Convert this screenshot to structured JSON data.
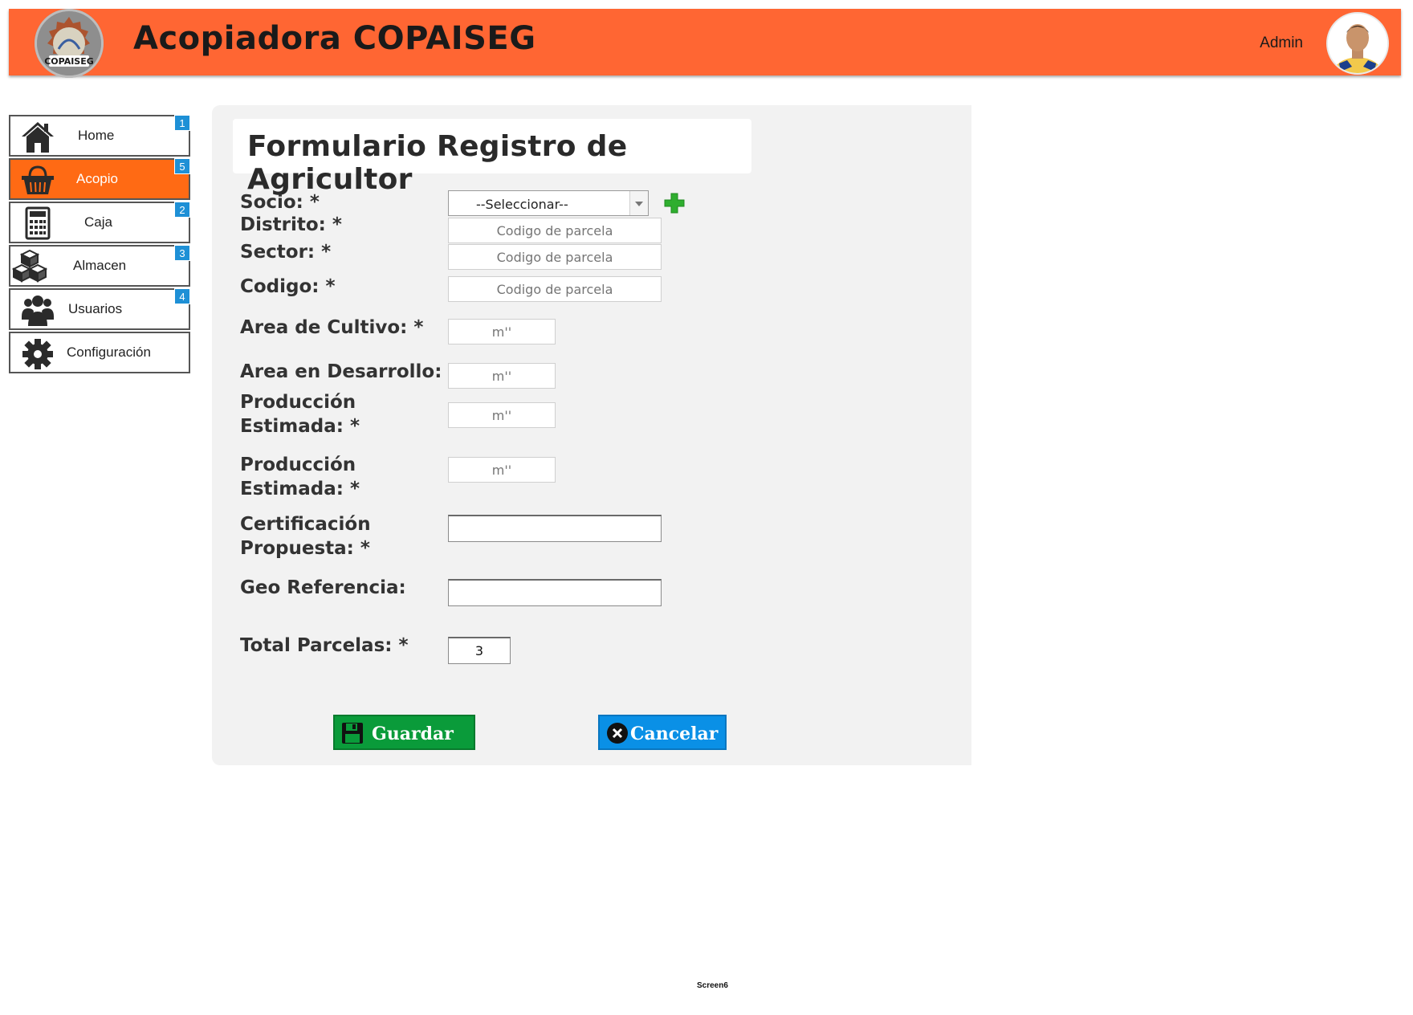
{
  "header": {
    "app_title": "Acopiadora COPAISEG",
    "logo_text": "COPAISEG",
    "user_name": "Admin",
    "brand_color": "#ff6633"
  },
  "sidebar": {
    "items": [
      {
        "label": "Home",
        "icon": "home-icon",
        "badge": "1",
        "active": false
      },
      {
        "label": "Acopio",
        "icon": "basket-icon",
        "badge": "5",
        "active": true
      },
      {
        "label": "Caja",
        "icon": "calculator-icon",
        "badge": "2",
        "active": false
      },
      {
        "label": "Almacen",
        "icon": "boxes-icon",
        "badge": "3",
        "active": false
      },
      {
        "label": "Usuarios",
        "icon": "users-icon",
        "badge": "4",
        "active": false
      },
      {
        "label": "Configuración",
        "icon": "gear-icon",
        "badge": "",
        "active": false
      }
    ],
    "active_color": "#ff6a14",
    "badge_color": "#1e90d6"
  },
  "form": {
    "title": "Formulario Registro de Agricultor",
    "labels": {
      "socio": "Socio: *",
      "distrito": "Distrito: *",
      "sector": "Sector: *",
      "codigo": "Codigo: *",
      "area_cultivo": "Area de Cultivo: *",
      "area_desarrollo": "Area en Desarrollo: *",
      "produccion1_l1": "Producción",
      "produccion1_l2": "Estimada:  *",
      "produccion2_l1": "Producción",
      "produccion2_l2": "Estimada: *",
      "certificacion_l1": "Certificación",
      "certificacion_l2": "Propuesta: *",
      "geo": "Geo Referencia:",
      "total": "Total Parcelas: *"
    },
    "socio_select": "--Seleccionar--",
    "placeholders": {
      "distrito": "Codigo de parcela",
      "sector": "Codigo de parcela",
      "codigo": "Codigo de parcela",
      "area_cultivo": "m''",
      "area_desarrollo": "m''",
      "produccion1": "m''",
      "produccion2": "m''"
    },
    "total_parcelas": "3",
    "buttons": {
      "save": "Guardar",
      "cancel": "Cancelar"
    },
    "save_color": "#0a9b3a",
    "cancel_color": "#0a90e6"
  },
  "footer": {
    "screen_label": "Screen6"
  }
}
